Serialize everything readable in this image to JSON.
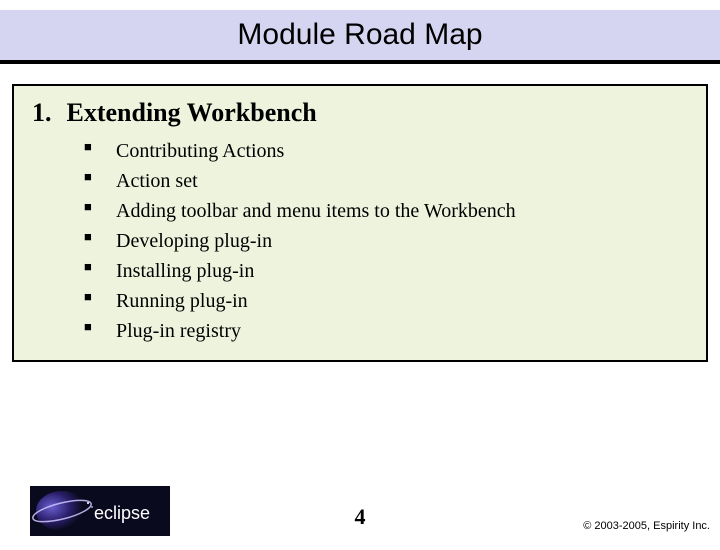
{
  "title": "Module Road Map",
  "section": {
    "number": "1.",
    "heading": "Extending Workbench",
    "bullets": [
      "Contributing Actions",
      "Action set",
      "Adding toolbar and menu items to the Workbench",
      "Developing plug-in",
      "Installing plug-in",
      "Running plug-in",
      "Plug-in registry"
    ]
  },
  "footer": {
    "page": "4",
    "copyright": "© 2003-2005, Espirity Inc.",
    "logo_text": "eclipse"
  }
}
